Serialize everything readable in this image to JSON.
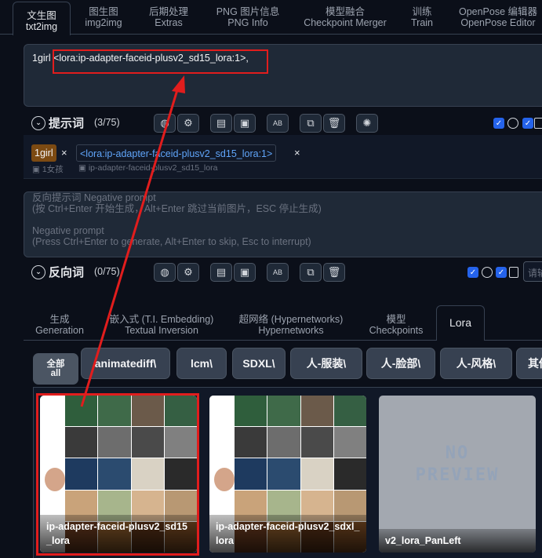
{
  "top_tabs": [
    {
      "line1": "文生图",
      "line2": "txt2img",
      "active": true
    },
    {
      "line1": "图生图",
      "line2": "img2img"
    },
    {
      "line1": "后期处理",
      "line2": "Extras"
    },
    {
      "line1": "PNG 图片信息",
      "line2": "PNG Info"
    },
    {
      "line1": "模型融合",
      "line2": "Checkpoint Merger"
    },
    {
      "line1": "训练",
      "line2": "Train"
    },
    {
      "line1": "OpenPose 编辑器",
      "line2": "OpenPose Editor"
    }
  ],
  "prompt": {
    "prefix": "1girl ",
    "lora": "<lora:ip-adapter-faceid-plusv2_sd15_lora:1>",
    "suffix": ","
  },
  "prompt_row": {
    "title": "提示词",
    "count": "(3/75)"
  },
  "tags": [
    {
      "text": "1girl",
      "sub": "1女孩"
    },
    {
      "text": "<lora:ip-adapter-faceid-plusv2_sd15_lora:1>",
      "sub": "ip-adapter-faceid-plusv2_sd15_lora"
    }
  ],
  "tag_close": "×",
  "negative_prompt": {
    "placeholder_lines": [
      "反向提示词 Negative prompt",
      "(按 Ctrl+Enter 开始生成，Alt+Enter 跳过当前图片，ESC 停止生成)",
      "",
      "Negative prompt",
      "(Press Ctrl+Enter to generate, Alt+Enter to skip, Esc to interrupt)"
    ]
  },
  "negative_row": {
    "title": "反向词",
    "count": "(0/75)",
    "right_input": "请输"
  },
  "network_tabs": [
    {
      "line1": "生成",
      "line2": "Generation"
    },
    {
      "line1": "嵌入式 (T.I. Embedding)",
      "line2": "Textual Inversion"
    },
    {
      "line1": "超网络 (Hypernetworks)",
      "line2": "Hypernetworks"
    },
    {
      "line1": "模型",
      "line2": "Checkpoints"
    },
    {
      "line1": "Lora",
      "line2": "",
      "active": true
    }
  ],
  "filters": {
    "all_line1": "全部",
    "all_line2": "all",
    "items": [
      "animatediff\\",
      "lcm\\",
      "SDXL\\",
      "人-服装\\",
      "人-脸部\\",
      "人-风格\\",
      "其他"
    ]
  },
  "cards": [
    {
      "name": "ip-adapter-faceid-plusv2_sd15_lora",
      "line1": "ip-adapter-faceid-plusv2_sd15",
      "line2": "_lora",
      "highlighted": true
    },
    {
      "name": "ip-adapter-faceid-plusv2_sdxl_lora",
      "line1": "ip-adapter-faceid-plusv2_sdxl_",
      "line2": "lora"
    },
    {
      "name": "v2_lora_PanLeft",
      "line1": "v2_lora_PanLeft",
      "line2": "",
      "no_preview": "NO\nPREVIEW"
    }
  ],
  "colors": {
    "highlight_red": "#e11d1d",
    "checkbox_blue": "#2563eb",
    "tag_1girl_bg": "#7c4a12",
    "lora_tag_color": "#60a5fa"
  }
}
